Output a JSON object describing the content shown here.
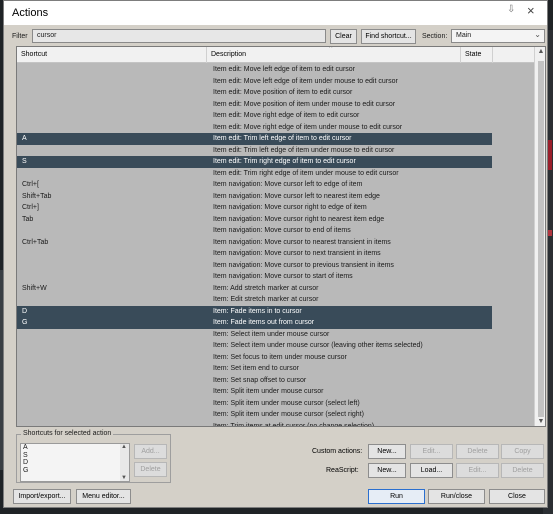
{
  "window": {
    "title": "Actions",
    "pin_glyph": "⇩",
    "close_glyph": "×"
  },
  "filter": {
    "label": "Filter",
    "value": "cursor"
  },
  "buttons": {
    "clear": "Clear",
    "find_shortcut": "Find shortcut...",
    "add": "Add...",
    "delete": "Delete",
    "new": "New...",
    "edit": "Edit...",
    "copy": "Copy",
    "load": "Load...",
    "import_export": "Import/export...",
    "menu_editor": "Menu editor...",
    "run": "Run",
    "run_close": "Run/close",
    "close": "Close"
  },
  "section": {
    "label": "Section:",
    "value": "Main"
  },
  "columns": {
    "shortcut": "Shortcut",
    "description": "Description",
    "state": "State"
  },
  "rows": [
    {
      "shortcut": "",
      "description": "Item edit: Move left edge of item to edit cursor",
      "selected": false
    },
    {
      "shortcut": "",
      "description": "Item edit: Move left edge of item under mouse to edit cursor",
      "selected": false
    },
    {
      "shortcut": "",
      "description": "Item edit: Move position of item to edit cursor",
      "selected": false
    },
    {
      "shortcut": "",
      "description": "Item edit: Move position of item under mouse to edit cursor",
      "selected": false
    },
    {
      "shortcut": "",
      "description": "Item edit: Move right edge of item to edit cursor",
      "selected": false
    },
    {
      "shortcut": "",
      "description": "Item edit: Move right edge of item under mouse to edit cursor",
      "selected": false
    },
    {
      "shortcut": "A",
      "description": "Item edit: Trim left edge of item to edit cursor",
      "selected": true
    },
    {
      "shortcut": "",
      "description": "Item edit: Trim left edge of item under mouse to edit cursor",
      "selected": false
    },
    {
      "shortcut": "S",
      "description": "Item edit: Trim right edge of item to edit cursor",
      "selected": true
    },
    {
      "shortcut": "",
      "description": "Item edit: Trim right edge of item under mouse to edit cursor",
      "selected": false
    },
    {
      "shortcut": "Ctrl+[",
      "description": "Item navigation: Move cursor left to edge of item",
      "selected": false
    },
    {
      "shortcut": "Shift+Tab",
      "description": "Item navigation: Move cursor left to nearest item edge",
      "selected": false
    },
    {
      "shortcut": "Ctrl+]",
      "description": "Item navigation: Move cursor right to edge of item",
      "selected": false
    },
    {
      "shortcut": "Tab",
      "description": "Item navigation: Move cursor right to nearest item edge",
      "selected": false
    },
    {
      "shortcut": "",
      "description": "Item navigation: Move cursor to end of items",
      "selected": false
    },
    {
      "shortcut": "Ctrl+Tab",
      "description": "Item navigation: Move cursor to nearest transient in items",
      "selected": false
    },
    {
      "shortcut": "",
      "description": "Item navigation: Move cursor to next transient in items",
      "selected": false
    },
    {
      "shortcut": "",
      "description": "Item navigation: Move cursor to previous transient in items",
      "selected": false
    },
    {
      "shortcut": "",
      "description": "Item navigation: Move cursor to start of items",
      "selected": false
    },
    {
      "shortcut": "Shift+W",
      "description": "Item: Add stretch marker at cursor",
      "selected": false
    },
    {
      "shortcut": "",
      "description": "Item: Edit stretch marker at cursor",
      "selected": false
    },
    {
      "shortcut": "D",
      "description": "Item: Fade items in to cursor",
      "selected": true
    },
    {
      "shortcut": "G",
      "description": "Item: Fade items out from cursor",
      "selected": true
    },
    {
      "shortcut": "",
      "description": "Item: Select item under mouse cursor",
      "selected": false
    },
    {
      "shortcut": "",
      "description": "Item: Select item under mouse cursor (leaving other items selected)",
      "selected": false
    },
    {
      "shortcut": "",
      "description": "Item: Set focus to item under mouse cursor",
      "selected": false
    },
    {
      "shortcut": "",
      "description": "Item: Set item end to cursor",
      "selected": false
    },
    {
      "shortcut": "",
      "description": "Item: Set snap offset to cursor",
      "selected": false
    },
    {
      "shortcut": "",
      "description": "Item: Split item under mouse cursor",
      "selected": false
    },
    {
      "shortcut": "",
      "description": "Item: Split item under mouse cursor (select left)",
      "selected": false
    },
    {
      "shortcut": "",
      "description": "Item: Split item under mouse cursor (select right)",
      "selected": false
    },
    {
      "shortcut": "",
      "description": "Item: Trim items at edit cursor (no change selection)",
      "selected": false
    }
  ],
  "shortcuts_panel": {
    "legend": "Shortcuts for selected action",
    "items": [
      "A",
      "S",
      "D",
      "G"
    ]
  },
  "custom_actions": {
    "label": "Custom actions:"
  },
  "reascript": {
    "label": "ReaScript:"
  }
}
